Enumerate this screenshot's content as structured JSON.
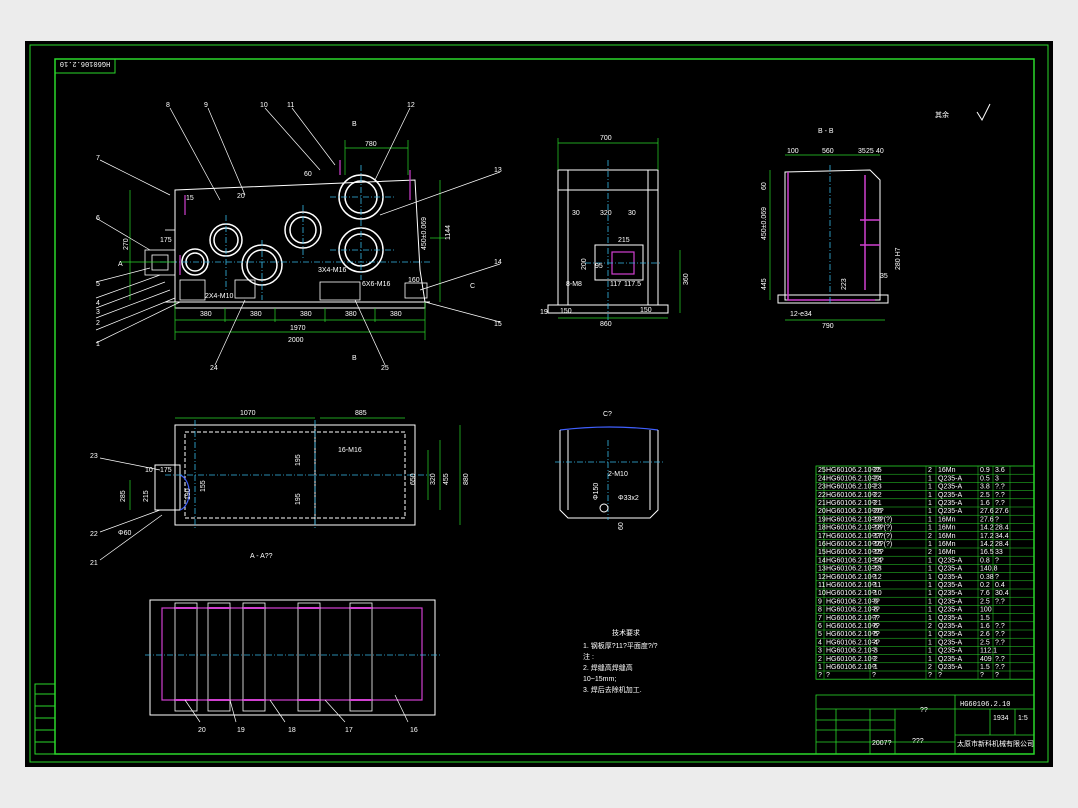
{
  "drawing_number": "HG60106.2.10",
  "drawing_number_mirrored": "HG60106.2.10",
  "roughness_mark": "其余",
  "section_labels": {
    "bb_view": "B - B",
    "aa_view": "A - A??",
    "c_view": "C?",
    "b_cut": "B",
    "a_cut": "A",
    "c_cut": "C"
  },
  "part_callouts": [
    "1",
    "2",
    "3",
    "4",
    "5",
    "6",
    "7",
    "8",
    "9",
    "10",
    "11",
    "12",
    "13",
    "14",
    "15",
    "16",
    "17",
    "18",
    "19",
    "20",
    "21",
    "22",
    "23",
    "24",
    "25"
  ],
  "dimensions": {
    "front": [
      "380",
      "380",
      "380",
      "380",
      "380",
      "1970",
      "2000",
      "1144",
      "450±0.069",
      "270",
      "175",
      "10",
      "190",
      "15",
      "20",
      "60",
      "23",
      "780",
      "20",
      "20",
      "D",
      "A",
      "2X4-M10",
      "6X6-M16",
      "3X4-M16",
      "6X6",
      "178",
      "3X4",
      "160",
      "445"
    ],
    "side": [
      "700",
      "30",
      "320",
      "30",
      "215",
      "95",
      "200",
      "8-M8",
      "117",
      "117.5",
      "360",
      "150",
      "150",
      "860",
      "19"
    ],
    "bb": [
      "100",
      "560",
      "35",
      "25",
      "40",
      "60",
      "450±0.069",
      "280 H7",
      "445",
      "223",
      "35",
      "12-e34",
      "790"
    ],
    "plan": [
      "1070",
      "885",
      "10",
      "175",
      "285",
      "215",
      "155",
      "190",
      "195",
      "195",
      "650",
      "880",
      "320",
      "455",
      "16-M16",
      "Φ60",
      "8"
    ],
    "c": [
      "2-M10",
      "Φ150",
      "Φ33x2",
      "50",
      "60"
    ]
  },
  "tech_requirements": {
    "title": "技术要求",
    "items": [
      "1. 钢板厚?11?平面度?/?",
      "注 :",
      "2. 焊缝高焊缝高",
      "10~15mm;",
      "3. 焊后去除机加工."
    ]
  },
  "bom": [
    [
      "25",
      "HG60106.2.10-25",
      "??",
      "2",
      "16Mn",
      "0.9",
      "3.6"
    ],
    [
      "24",
      "HG60106.2.10-24",
      "??",
      "1",
      "Q235-A",
      "0.5",
      "3"
    ],
    [
      "23",
      "HG60106.2.10-23",
      "?",
      "1",
      "Q235-A",
      "3.8",
      "?.?"
    ],
    [
      "22",
      "HG60106.2.10-22",
      "?",
      "1",
      "Q235-A",
      "2.5",
      "?.?"
    ],
    [
      "21",
      "HG60106.2.10-21",
      "?",
      "1",
      "Q235-A",
      "1.6",
      "?.?"
    ],
    [
      "20",
      "HG60106.2.10-20",
      "???",
      "1",
      "Q235-A",
      "27.6",
      "27.6"
    ],
    [
      "19",
      "HG60106.2.10-19",
      "???(?)",
      "1",
      "16Mn",
      "27.6",
      "?"
    ],
    [
      "18",
      "HG60106.2.10-18",
      "???(?)",
      "1",
      "16Mn",
      "14.2",
      "28.4"
    ],
    [
      "17",
      "HG60106.2.10-17",
      "???(?)",
      "2",
      "16Mn",
      "17.2",
      "34.4"
    ],
    [
      "16",
      "HG60106.2.10-16",
      "???(?)",
      "1",
      "16Mn",
      "14.2",
      "28.4"
    ],
    [
      "15",
      "HG60106.2.10-15",
      "???",
      "2",
      "16Mn",
      "16.5",
      "33"
    ],
    [
      "14",
      "HG60106.2.10-14",
      "???",
      "1",
      "Q235-A",
      "0.8",
      "?"
    ],
    [
      "13",
      "HG60106.2.10-13",
      "??",
      "1",
      "Q235-A",
      "140.8",
      ""
    ],
    [
      "12",
      "HG60106.2.10-12",
      "?",
      "1",
      "Q235-A",
      "0.38",
      "?"
    ],
    [
      "11",
      "HG60106.2.10-11",
      "?",
      "1",
      "Q235-A",
      "0.2",
      "0.4"
    ],
    [
      "10",
      "HG60106.2.10-10",
      "?",
      "1",
      "Q235-A",
      "7.6",
      "30.4"
    ],
    [
      "9",
      "HG60106.2.10-9",
      "??",
      "1",
      "Q235-A",
      "2.5",
      "?.?"
    ],
    [
      "8",
      "HG60106.2.10-8",
      "??",
      "1",
      "Q235-A",
      "100",
      ""
    ],
    [
      "7",
      "HG60106.2.10-7",
      "??",
      "1",
      "Q235-A",
      "1.5",
      ""
    ],
    [
      "6",
      "HG60106.2.10-6",
      "??",
      "2",
      "Q235-A",
      "1.6",
      "?.?"
    ],
    [
      "5",
      "HG60106.2.10-5",
      "??",
      "1",
      "Q235-A",
      "2.6",
      "?.?"
    ],
    [
      "4",
      "HG60106.2.10-4",
      "??",
      "1",
      "Q235-A",
      "2.5",
      "?.?"
    ],
    [
      "3",
      "HG60106.2.10-3",
      "?",
      "1",
      "Q235-A",
      "112.1",
      ""
    ],
    [
      "2",
      "HG60106.2.10-2",
      "?",
      "1",
      "Q235-A",
      "409",
      "?.?"
    ],
    [
      "1",
      "HG60106.2.10-1",
      "?",
      "2",
      "Q235-A",
      "1.5",
      "?.?"
    ]
  ],
  "bom_header": [
    "?",
    "?",
    "?",
    "?",
    "?",
    "?",
    "?"
  ],
  "title_block": {
    "name": "??",
    "scale": "1:5",
    "weight": "1934",
    "sheet": "???",
    "year": "2007?",
    "company": "太原市新科机械有限公司"
  }
}
